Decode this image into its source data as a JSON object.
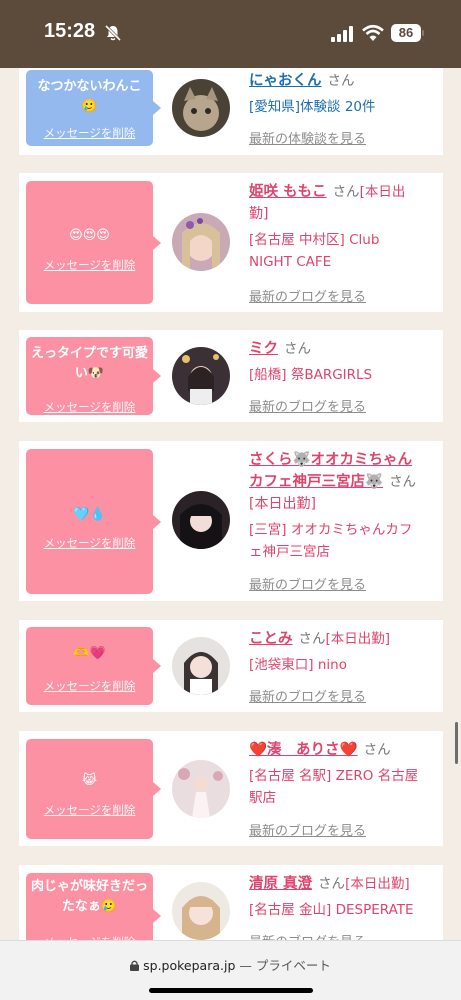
{
  "status": {
    "time": "15:28",
    "battery": "86"
  },
  "cards": [
    {
      "message": "なつかないわんこ🥲",
      "delete_label": "メッセージを削除",
      "name": "にゃおくん",
      "honorific": "さん",
      "schedule": "",
      "shop_line1": "[愛知県]体験談 20件",
      "shop_line2": "",
      "latest": "最新の体験談を見る"
    },
    {
      "message": "😍😍😍",
      "delete_label": "メッセージを削除",
      "name": "姫咲 ももこ",
      "name_line2": "勤]",
      "honorific": "さん",
      "schedule": "[本日出",
      "shop_line1": "[名古屋 中村区] Club",
      "shop_line2": "NIGHT CAFE",
      "latest": "最新のブログを見る"
    },
    {
      "message": "えっタイプです可愛い🐶",
      "delete_label": "メッセージを削除",
      "name": "ミク",
      "honorific": "さん",
      "schedule": "",
      "shop_line1": "[船橋] 祭BARGIRLS",
      "shop_line2": "",
      "latest": "最新のブログを見る"
    },
    {
      "message": "🩵💧",
      "delete_label": "メッセージを削除",
      "name": "さくら🐺オオカミちゃんカフェ神戸三宮店🐺",
      "name_line1": "さくら🐺オオカミちゃん",
      "name_line2": "カフェ神戸三宮店🐺",
      "honorific": "さん",
      "schedule": "[本日出勤]",
      "shop_line1": "[三宮] オオカミちゃんカフ",
      "shop_line2": "ェ神戸三宮店",
      "latest": "最新のブログを見る"
    },
    {
      "message": "🫶💗",
      "delete_label": "メッセージを削除",
      "name": "ことみ",
      "honorific": "さん",
      "schedule": "[本日出勤]",
      "shop_line1": "[池袋東口] nino",
      "shop_line2": "",
      "latest": "最新のブログを見る"
    },
    {
      "message": "😹",
      "delete_label": "メッセージを削除",
      "name": "❤️湊　ありさ❤️",
      "honorific": "さん",
      "schedule": "",
      "shop_line1": "[名古屋 名駅] ZERO 名古屋",
      "shop_line2": "駅店",
      "latest": "最新のブログを見る"
    },
    {
      "message": "肉じゃが味好きだったなぁ🥲",
      "delete_label": "メッセージを削除",
      "name": "清原 真澄",
      "honorific": "さん",
      "schedule": "[本日出勤]",
      "shop_line1": "[名古屋 金山] DESPERATE",
      "shop_line2": "",
      "latest": "最新のブログを見る"
    }
  ],
  "browser": {
    "domain": "sp.pokepara.jp",
    "mode": "— プライベート"
  },
  "colors": {
    "pink": "#fc91a3",
    "blue_bubble": "#94b9ef",
    "accent": "#e0446d",
    "link_blue": "#1d6fae",
    "status_bar": "#5c4b3b",
    "background": "#f4ede5"
  }
}
